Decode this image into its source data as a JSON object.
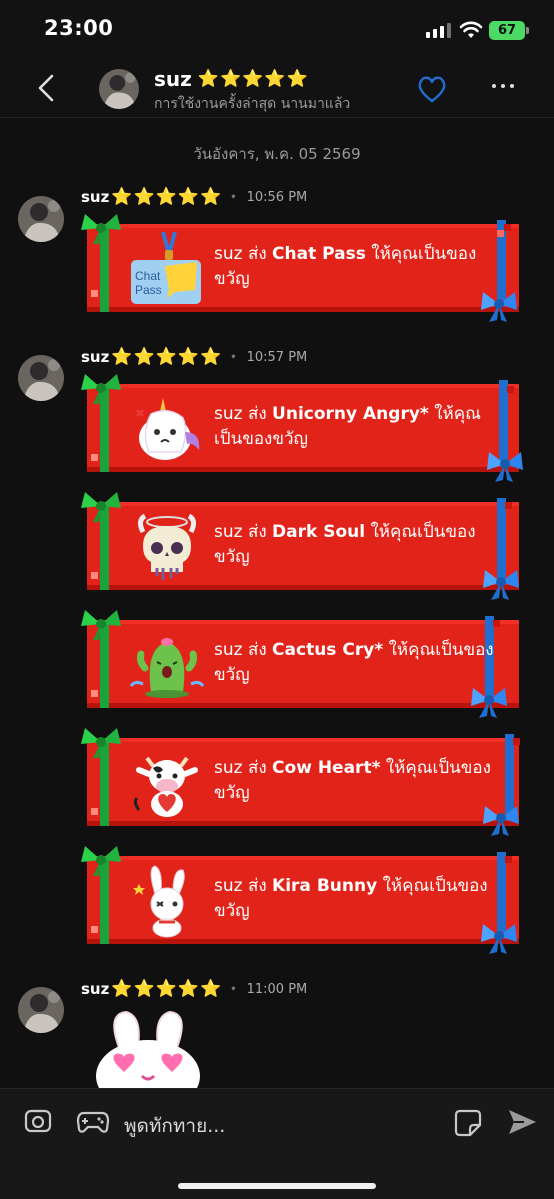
{
  "status": {
    "time": "23:00",
    "battery": "67"
  },
  "header": {
    "name": "suz",
    "stars": "⭐⭐⭐⭐⭐",
    "subtitle": "การใช้งานครั้งล่าสุด นานมาแล้ว"
  },
  "date_divider": "วันอังคาร, พ.ค. 05 2569",
  "messages": [
    {
      "sender": "suz",
      "stars": "⭐⭐⭐⭐⭐",
      "time": "10:56 PM",
      "gifts": [
        {
          "prefix": "suz ส่ง ",
          "item": "Chat Pass",
          "suffix": " ให้คุณเป็นของขวัญ",
          "icon": "chat-pass-icon"
        }
      ]
    },
    {
      "sender": "suz",
      "stars": "⭐⭐⭐⭐⭐",
      "time": "10:57 PM",
      "gifts": [
        {
          "prefix": "suz ส่ง ",
          "item": "Unicorny Angry*",
          "suffix": " ให้คุณเป็นของขวัญ",
          "icon": "unicorn-sticker-icon"
        },
        {
          "prefix": "suz ส่ง ",
          "item": "Dark Soul",
          "suffix": " ให้คุณเป็นของขวัญ",
          "icon": "skull-sticker-icon"
        },
        {
          "prefix": "suz ส่ง ",
          "item": "Cactus Cry*",
          "suffix": " ให้คุณเป็นของขวัญ",
          "icon": "cactus-sticker-icon"
        },
        {
          "prefix": "suz ส่ง ",
          "item": "Cow Heart*",
          "suffix": " ให้คุณเป็นของขวัญ",
          "icon": "cow-sticker-icon"
        },
        {
          "prefix": "suz ส่ง ",
          "item": "Kira Bunny",
          "suffix": " ให้คุณเป็นของขวัญ",
          "icon": "bunny-sticker-icon"
        }
      ]
    },
    {
      "sender": "suz",
      "stars": "⭐⭐⭐⭐⭐",
      "time": "11:00 PM",
      "sticker": "bunny-sticker-icon"
    }
  ],
  "input": {
    "placeholder": "พูดทักทาย..."
  },
  "colors": {
    "gift_red": "#e2231a",
    "ribbon_green": "#18a43a",
    "ribbon_blue": "#1f6fd1",
    "accent_blue": "#1f6fd1"
  }
}
